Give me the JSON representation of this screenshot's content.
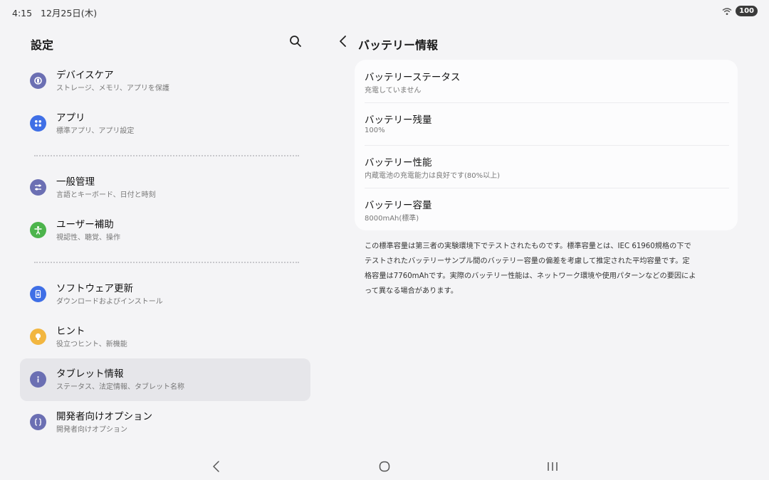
{
  "status": {
    "time": "4:15",
    "date": "12月25日(木)",
    "battery": "100"
  },
  "left": {
    "title": "設定",
    "items": [
      {
        "label": "デバイスケア",
        "sub": "ストレージ、メモリ、アプリを保護",
        "icon": "device-care-icon",
        "color": "#6b6fb3"
      },
      {
        "label": "アプリ",
        "sub": "標準アプリ、アプリ設定",
        "icon": "apps-icon",
        "color": "#3f6fe6"
      },
      {
        "label": "一般管理",
        "sub": "言語とキーボード、日付と時刻",
        "icon": "sliders-icon",
        "color": "#6b6fb3"
      },
      {
        "label": "ユーザー補助",
        "sub": "視認性、聴覚、操作",
        "icon": "accessibility-icon",
        "color": "#4cb44c"
      },
      {
        "label": "ソフトウェア更新",
        "sub": "ダウンロードおよびインストール",
        "icon": "software-update-icon",
        "color": "#3f6fe6"
      },
      {
        "label": "ヒント",
        "sub": "役立つヒント、新機能",
        "icon": "bulb-icon",
        "color": "#f2b640"
      },
      {
        "label": "タブレット情報",
        "sub": "ステータス、法定情報、タブレット名称",
        "icon": "info-icon",
        "color": "#6b6fb3"
      },
      {
        "label": "開発者向けオプション",
        "sub": "開発者向けオプション",
        "icon": "braces-icon",
        "color": "#6b6fb3"
      }
    ]
  },
  "right": {
    "title": "バッテリー情報",
    "rows": [
      {
        "label": "バッテリーステータス",
        "value": "充電していません"
      },
      {
        "label": "バッテリー残量",
        "value": "100%"
      },
      {
        "label": "バッテリー性能",
        "value": "内蔵電池の充電能力は良好です(80%以上)"
      },
      {
        "label": "バッテリー容量",
        "value": "8000mAh(標準)"
      }
    ],
    "note_lines": [
      "この標準容量は第三者の実験環境下でテストされたものです。標準容量とは、IEC 61960規格の下で",
      "テストされたバッテリーサンプル間のバッテリー容量の偏差を考慮して推定された平均容量です。定",
      "格容量は7760mAhです。実際のバッテリー性能は、ネットワーク環境や使用パターンなどの要因によ",
      "って異なる場合があります。"
    ]
  }
}
